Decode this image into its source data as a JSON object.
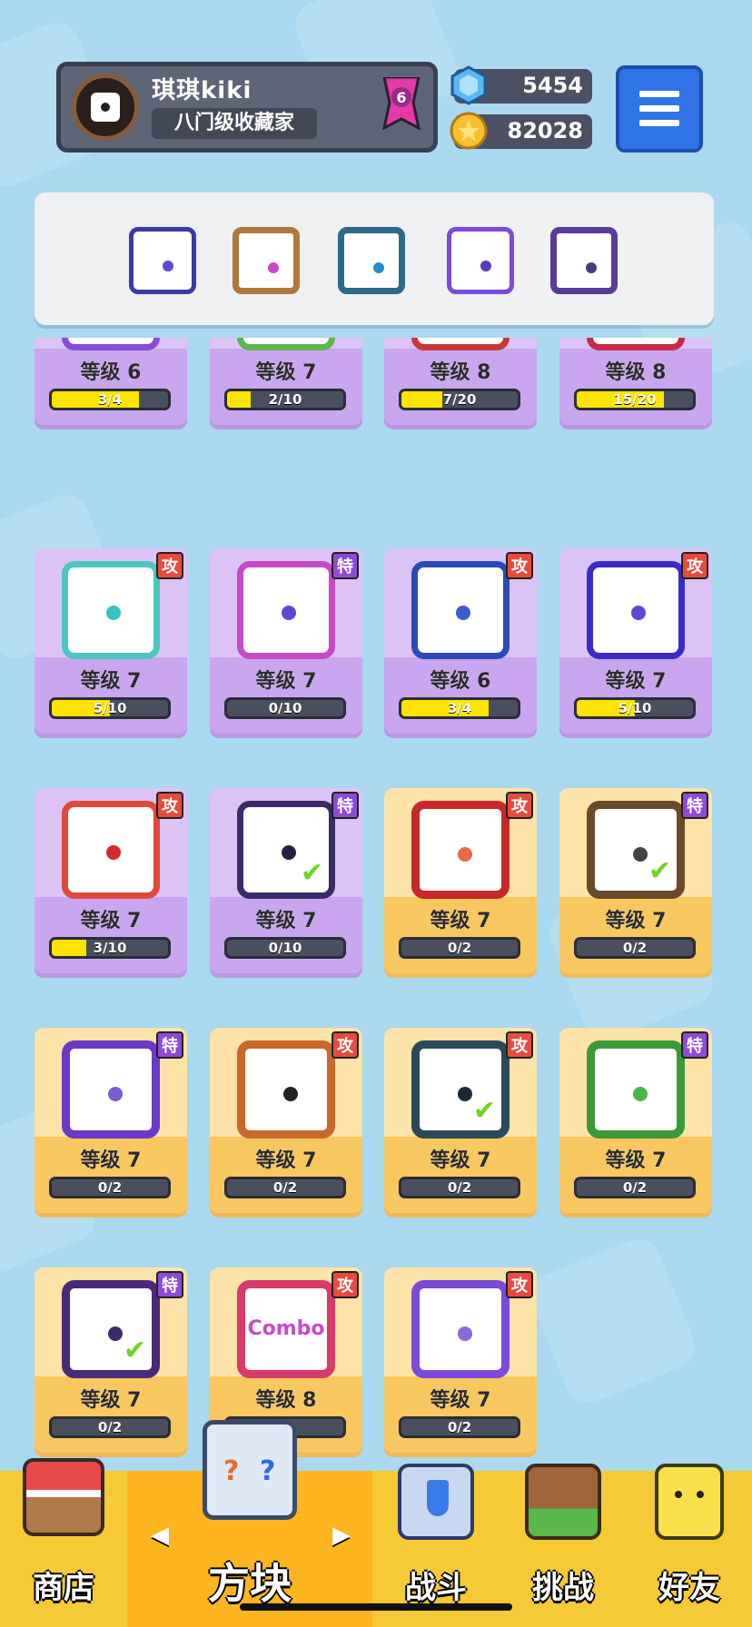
{
  "profile": {
    "name": "琪琪kiki",
    "title": "八门级收藏家",
    "rank": "6",
    "gems": "5454",
    "coins": "82028"
  },
  "deck": [
    {
      "icon": "healing-hands-dice",
      "color": "#5ec8b8"
    },
    {
      "icon": "infinity-dice",
      "color": "#c8a8e8"
    },
    {
      "icon": "whirlwind-dice",
      "color": "#4ab0d8"
    },
    {
      "icon": "crack-dice",
      "color": "#9a6ad8"
    },
    {
      "icon": "void-dice",
      "color": "#7a5ab8"
    }
  ],
  "cards": [
    {
      "level": "等级 6",
      "progress": "3/4",
      "fill": 0.75,
      "style": "purple",
      "tag": "",
      "icon": "rainbow-dice",
      "pip": "#9a7ae8",
      "border": "#8a4ad8"
    },
    {
      "level": "等级 7",
      "progress": "2/10",
      "fill": 0.2,
      "style": "purple",
      "tag": "",
      "icon": "biohazard-dice",
      "pip": "#44a83c",
      "border": "#5ab84a"
    },
    {
      "level": "等级 8",
      "progress": "7/20",
      "fill": 0.35,
      "style": "purple",
      "tag": "",
      "icon": "lightning-dice",
      "pip": "#e04848",
      "border": "#c83838"
    },
    {
      "level": "等级 8",
      "progress": "15/20",
      "fill": 0.75,
      "style": "purple",
      "tag": "",
      "icon": "cross-dice",
      "pip": "#e04848",
      "border": "#c8284a"
    },
    {
      "level": "等级 7",
      "progress": "5/10",
      "fill": 0.5,
      "style": "purple",
      "tag": "攻",
      "icon": "wind-dice",
      "pip": "#3ac0c0",
      "border": "#4ac8c0"
    },
    {
      "level": "等级 7",
      "progress": "0/10",
      "fill": 0,
      "style": "purple",
      "tag": "特",
      "icon": "swap-dice",
      "pip": "#5a4ad8",
      "border": "#c84ac8"
    },
    {
      "level": "等级 6",
      "progress": "3/4",
      "fill": 0.75,
      "style": "purple",
      "tag": "攻",
      "icon": "gear-dice",
      "pip": "#3a5ad8",
      "border": "#2a4ab8"
    },
    {
      "level": "等级 7",
      "progress": "5/10",
      "fill": 0.5,
      "style": "purple",
      "tag": "攻",
      "icon": "bubble-dice",
      "pip": "#5a4ad8",
      "border": "#3a2ac8"
    },
    {
      "level": "等级 7",
      "progress": "3/10",
      "fill": 0.3,
      "style": "purple",
      "tag": "攻",
      "icon": "fire-dice",
      "pip": "#d82828",
      "border": "#e04838"
    },
    {
      "level": "等级 7",
      "progress": "0/10",
      "fill": 0,
      "style": "purple",
      "tag": "特",
      "icon": "shatter-dice",
      "pip": "#222244",
      "border": "#3a2a6a",
      "owned": true
    },
    {
      "level": "等级 7",
      "progress": "0/2",
      "fill": 0,
      "style": "gold",
      "tag": "攻",
      "icon": "star-burst-dice",
      "pip": "#e86a40",
      "border": "#c8282a"
    },
    {
      "level": "等级 7",
      "progress": "0/2",
      "fill": 0,
      "style": "gold",
      "tag": "特",
      "icon": "infinity-dice",
      "pip": "#444",
      "border": "#6a4a2a",
      "owned": true
    },
    {
      "level": "等级 7",
      "progress": "0/2",
      "fill": 0,
      "style": "gold",
      "tag": "特",
      "icon": "target-dice",
      "pip": "#7a5ad8",
      "border": "#6a3ac8"
    },
    {
      "level": "等级 7",
      "progress": "0/2",
      "fill": 0,
      "style": "gold",
      "tag": "攻",
      "icon": "gun-dice",
      "pip": "#222",
      "border": "#c8682a"
    },
    {
      "level": "等级 7",
      "progress": "0/2",
      "fill": 0,
      "style": "gold",
      "tag": "攻",
      "icon": "vortex-dice",
      "pip": "#1a2a3a",
      "border": "#2a4a5a",
      "owned": true
    },
    {
      "level": "等级 7",
      "progress": "0/2",
      "fill": 0,
      "style": "gold",
      "tag": "特",
      "icon": "seaweed-dice",
      "pip": "#4ab848",
      "border": "#3a9a3a"
    },
    {
      "level": "等级 7",
      "progress": "0/2",
      "fill": 0,
      "style": "gold",
      "tag": "特",
      "icon": "dark-void-dice",
      "pip": "#3a2a6a",
      "border": "#4a2a7a",
      "owned": true
    },
    {
      "level": "等级 8",
      "progress": "",
      "fill": 0,
      "style": "gold",
      "tag": "攻",
      "icon": "combo-dice",
      "pip": "#c84ac8",
      "border": "#d83a6a",
      "text": "Combo"
    },
    {
      "level": "等级 7",
      "progress": "0/2",
      "fill": 0,
      "style": "gold",
      "tag": "攻",
      "icon": "star-dice",
      "pip": "#8a6ad8",
      "border": "#7a4ad8"
    }
  ],
  "nav": {
    "shop": "商店",
    "dice": "方块",
    "battle": "战斗",
    "challenge": "挑战",
    "friends": "好友"
  },
  "colors": {
    "accent": "#2f74e6",
    "nav_bg": "#f6c936",
    "bg": "#a9d8ef"
  }
}
